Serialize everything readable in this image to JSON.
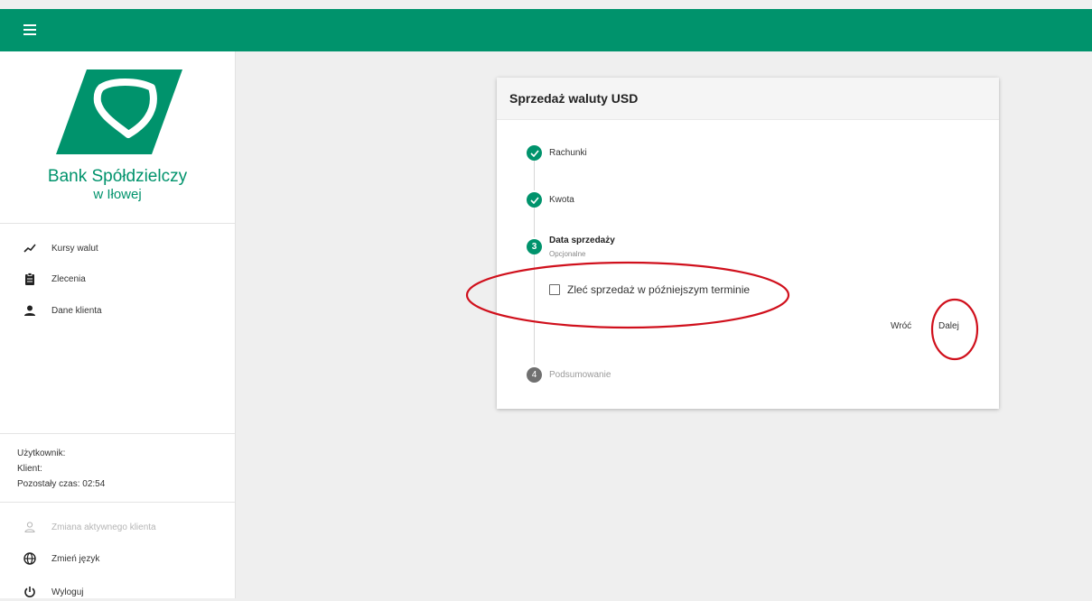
{
  "topbar": {
    "title": ""
  },
  "bank": {
    "name": "Bank Spółdzielczy",
    "location": "w Iłowej",
    "brand_color": "#00936c"
  },
  "sidebar": {
    "nav": [
      {
        "label": "Kursy walut",
        "icon": "trend-line-icon"
      },
      {
        "label": "Zlecenia",
        "icon": "clipboard-icon"
      },
      {
        "label": "Dane klienta",
        "icon": "person-icon"
      }
    ],
    "info": {
      "user_label": "Użytkownik:",
      "client_label": "Klient:",
      "time_label": "Pozostały czas: 02:54"
    },
    "bottom": [
      {
        "label": "Zmiana aktywnego klienta",
        "icon": "person-outline-icon",
        "disabled": true
      },
      {
        "label": "Zmień język",
        "icon": "globe-icon",
        "disabled": false
      },
      {
        "label": "Wyloguj",
        "icon": "power-icon",
        "disabled": false
      }
    ]
  },
  "card": {
    "title": "Sprzedaż waluty USD",
    "steps": [
      {
        "label": "Rachunki",
        "state": "done"
      },
      {
        "label": "Kwota",
        "state": "done"
      },
      {
        "number": "3",
        "label": "Data sprzedaży",
        "sublabel": "Opcjonalne",
        "state": "active"
      },
      {
        "number": "4",
        "label": "Podsumowanie",
        "state": "pending"
      }
    ],
    "checkbox_label": "Zleć sprzedaż w późniejszym terminie",
    "back_label": "Wróć",
    "next_label": "Dalej"
  }
}
